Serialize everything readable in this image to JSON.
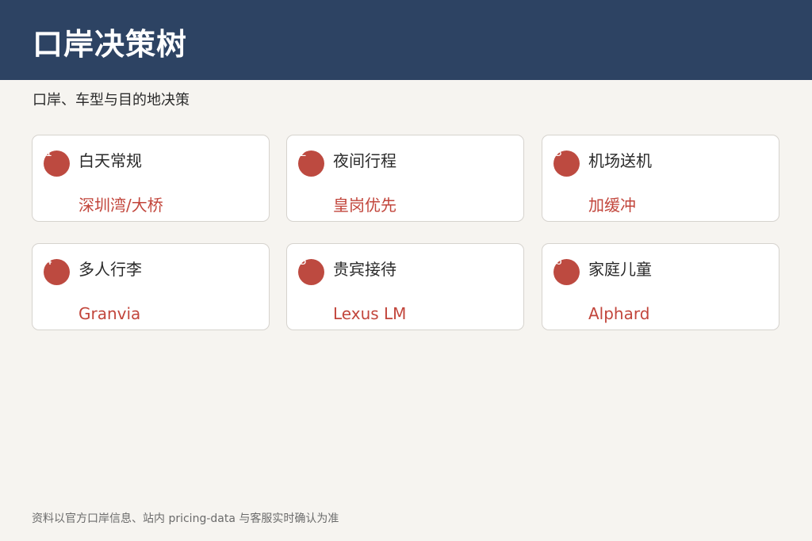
{
  "header": {
    "title": "口岸决策树"
  },
  "subtitle": "口岸、车型与目的地决策",
  "cards": [
    {
      "num": "1",
      "title": "白天常规",
      "value": "深圳湾/大桥"
    },
    {
      "num": "2",
      "title": "夜间行程",
      "value": "皇岗优先"
    },
    {
      "num": "3",
      "title": "机场送机",
      "value": "加缓冲"
    },
    {
      "num": "4",
      "title": "多人行李",
      "value": "Granvia"
    },
    {
      "num": "5",
      "title": "贵宾接待",
      "value": "Lexus LM"
    },
    {
      "num": "6",
      "title": "家庭儿童",
      "value": "Alphard"
    }
  ],
  "footer": "资料以官方口岸信息、站内 pricing-data 与客服实时确认为准",
  "colors": {
    "header_bg": "#2d4363",
    "accent": "#c2463c",
    "page_bg": "#f6f4f0"
  }
}
